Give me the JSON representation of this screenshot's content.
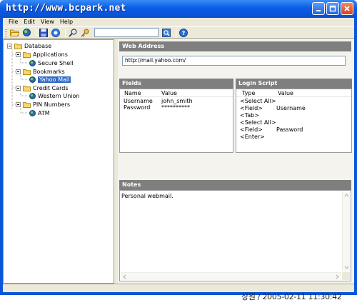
{
  "window": {
    "title": "http://www.bcpark.net",
    "controls": [
      "minimize",
      "maximize",
      "close"
    ]
  },
  "menu": {
    "items": [
      "File",
      "Edit",
      "View",
      "Help"
    ]
  },
  "toolbar": {
    "buttons": [
      "open-folder-icon",
      "globe-icon",
      "save-icon",
      "info-icon",
      "find-icon",
      "key-icon"
    ],
    "search_value": "",
    "go_icon": "go-icon",
    "help_icon": "help-icon"
  },
  "tree": {
    "root": "Database",
    "categories": [
      {
        "label": "Applications",
        "entries": [
          "Secure Shell"
        ]
      },
      {
        "label": "Bookmarks",
        "entries": [
          "Yahoo Mail"
        ]
      },
      {
        "label": "Credit Cards",
        "entries": [
          "Western Union"
        ]
      },
      {
        "label": "PIN Numbers",
        "entries": [
          "ATM"
        ]
      }
    ],
    "selected": "Yahoo Mail"
  },
  "web_address": {
    "header": "Web Address",
    "value": "http://mail.yahoo.com/"
  },
  "fields": {
    "header": "Fields",
    "columns": [
      "Name",
      "Value"
    ],
    "rows": [
      [
        "Username",
        "john_smith"
      ],
      [
        "Password",
        "**********"
      ]
    ]
  },
  "login_script": {
    "header": "Login Script",
    "columns": [
      "Type",
      "Value"
    ],
    "rows": [
      [
        "<Select All>",
        ""
      ],
      [
        "<Field>",
        "Username"
      ],
      [
        "<Tab>",
        ""
      ],
      [
        "<Select All>",
        ""
      ],
      [
        "<Field>",
        "Password"
      ],
      [
        "<Enter>",
        ""
      ]
    ]
  },
  "notes": {
    "header": "Notes",
    "text": "Personal webmail."
  },
  "caption": "상원 / 2005-02-11 11:30:42"
}
